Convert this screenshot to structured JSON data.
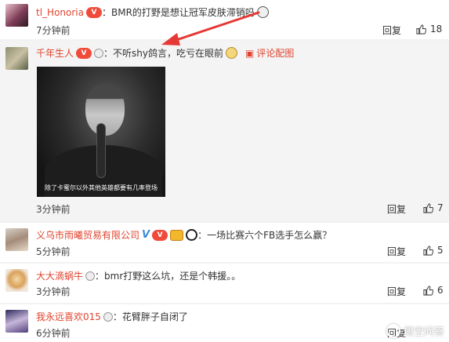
{
  "comments": [
    {
      "username": "tl_Honoria",
      "vip_badge": "V",
      "text": "：BMR的打野是想让冠军皮肤滞销吗",
      "time": "7分钟前",
      "reply_label": "回复",
      "likes": "18"
    },
    {
      "username": "千年生人",
      "vip_badge": "V",
      "text": "：不听shy鸽言，吃亏在眼前",
      "image_link_label": "评论配图",
      "image_caption": "除了卡蜜尔以外其他英雄都要有几率登场",
      "time": "3分钟前",
      "reply_label": "回复",
      "likes": "7"
    },
    {
      "username": "义乌市雨曦贸易有限公司",
      "verified_badge": "V",
      "vip_badge": "V",
      "text": "：一场比赛六个FB选手怎么赢？",
      "time": "5分钟前",
      "reply_label": "回复",
      "likes": "5"
    },
    {
      "username": "大大滴蜗牛",
      "text": "：bmr打野这么坑，还是个韩援。。",
      "time": "3分钟前",
      "reply_label": "回复",
      "likes": "6"
    },
    {
      "username": "我永远喜欢015",
      "text": "：花臂胖子自闭了",
      "time": "6分钟前",
      "reply_label": "回复"
    }
  ],
  "watermark": "悟空问答",
  "colors": {
    "username": "#e0442e",
    "arrow": "#e53935",
    "vip": "#f04a3a",
    "verified": "#3b8ad9"
  },
  "icons": [
    "thumbs-up-icon",
    "image-icon",
    "vip-crown-icon",
    "medal-icon",
    "emoji-icon",
    "arrow-annotation"
  ]
}
